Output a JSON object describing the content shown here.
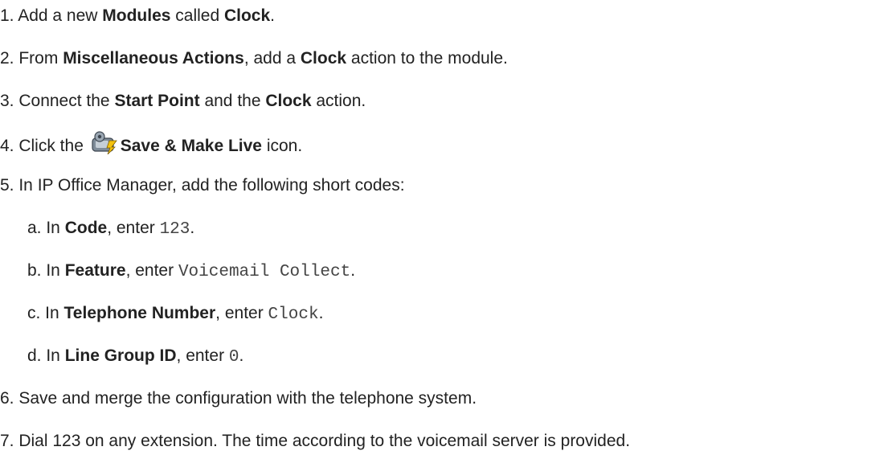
{
  "steps": [
    {
      "num": "1.",
      "t1": " Add a new ",
      "b1": "Modules",
      "t2": " called ",
      "b2": "Clock",
      "t3": "."
    },
    {
      "num": "2.",
      "t1": " From ",
      "b1": "Miscellaneous Actions",
      "t2": ", add a ",
      "b2": "Clock",
      "t3": " action to the module."
    },
    {
      "num": "3.",
      "t1": " Connect the ",
      "b1": "Start Point",
      "t2": " and the ",
      "b2": "Clock",
      "t3": " action."
    },
    {
      "num": "4.",
      "t1": " Click the ",
      "icon": "save-make-live-icon",
      "b1": "Save & Make Live",
      "t2": " icon."
    },
    {
      "num": "5.",
      "t1": " In IP Office Manager, add the following short codes:"
    },
    {
      "num": "6.",
      "t1": " Save and merge the configuration with the telephone system."
    },
    {
      "num": "7.",
      "t1": " Dial 123 on any extension. The time according to the voicemail server is provided."
    }
  ],
  "substeps": [
    {
      "num": "a.",
      "t1": " In ",
      "b1": "Code",
      "t2": ", enter ",
      "code": "123",
      "t3": "."
    },
    {
      "num": "b.",
      "t1": " In ",
      "b1": "Feature",
      "t2": ", enter ",
      "code": "Voicemail Collect",
      "t3": "."
    },
    {
      "num": "c.",
      "t1": " In ",
      "b1": "Telephone Number",
      "t2": ", enter ",
      "code": "Clock",
      "t3": "."
    },
    {
      "num": "d.",
      "t1": " In ",
      "b1": "Line Group ID",
      "t2": ", enter ",
      "code": "0",
      "t3": "."
    }
  ]
}
